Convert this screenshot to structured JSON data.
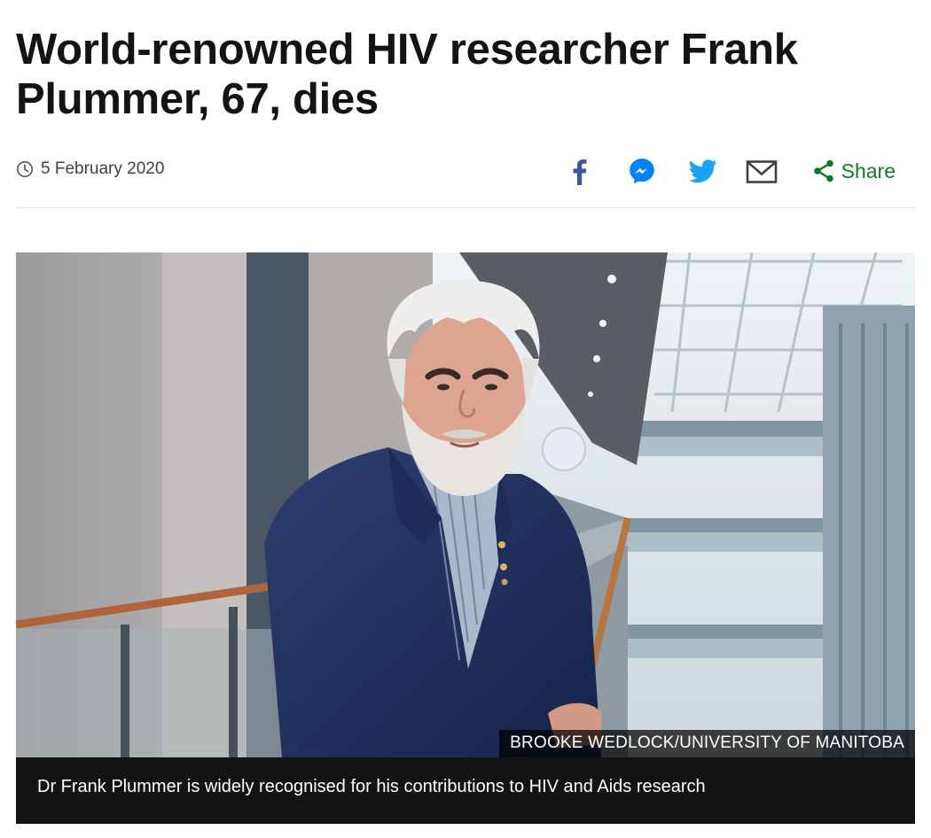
{
  "article": {
    "headline": "World-renowned HIV researcher Frank Plummer, 67, dies",
    "date": "5 February 2020",
    "share": {
      "label": "Share",
      "icons": [
        "facebook-icon",
        "messenger-icon",
        "twitter-icon",
        "email-icon",
        "share-icon"
      ],
      "colors": {
        "facebook": "#3b5998",
        "messenger": "#0084ff",
        "twitter": "#1da1f2",
        "email": "#404040",
        "share": "#0a7b1e"
      }
    },
    "image": {
      "credit": "BROOKE WEDLOCK/UNIVERSITY OF MANITOBA",
      "caption": "Dr Frank Plummer is widely recognised for his contributions to HIV and Aids research"
    }
  }
}
